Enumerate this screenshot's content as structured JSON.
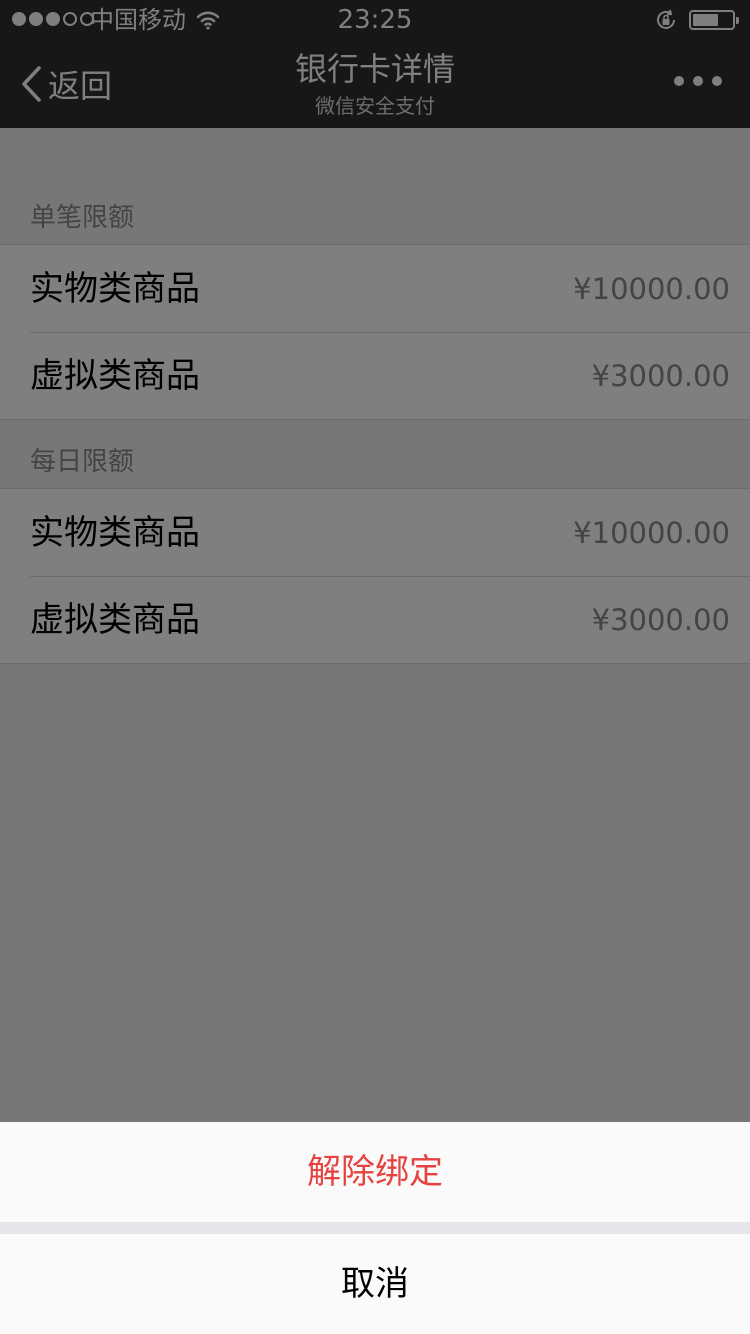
{
  "status_bar": {
    "carrier": "中国移动",
    "time": "23:25",
    "battery_level": 0.65,
    "signal_bars_filled": 3,
    "signal_bars_total": 5
  },
  "nav": {
    "back_label": "返回",
    "title": "银行卡详情",
    "subtitle": "微信安全支付",
    "more_icon": "more-dots-icon"
  },
  "sections": [
    {
      "header": "单笔限额",
      "rows": [
        {
          "name": "实物类商品",
          "value": "¥10000.00"
        },
        {
          "name": "虚拟类商品",
          "value": "¥3000.00"
        }
      ]
    },
    {
      "header": "每日限额",
      "rows": [
        {
          "name": "实物类商品",
          "value": "¥10000.00"
        },
        {
          "name": "虚拟类商品",
          "value": "¥3000.00"
        }
      ]
    }
  ],
  "action_sheet": {
    "unbind_label": "解除绑定",
    "cancel_label": "取消"
  },
  "colors": {
    "bar_background": "#2e2e33",
    "page_background": "#efeff4",
    "destructive": "#e64340"
  }
}
